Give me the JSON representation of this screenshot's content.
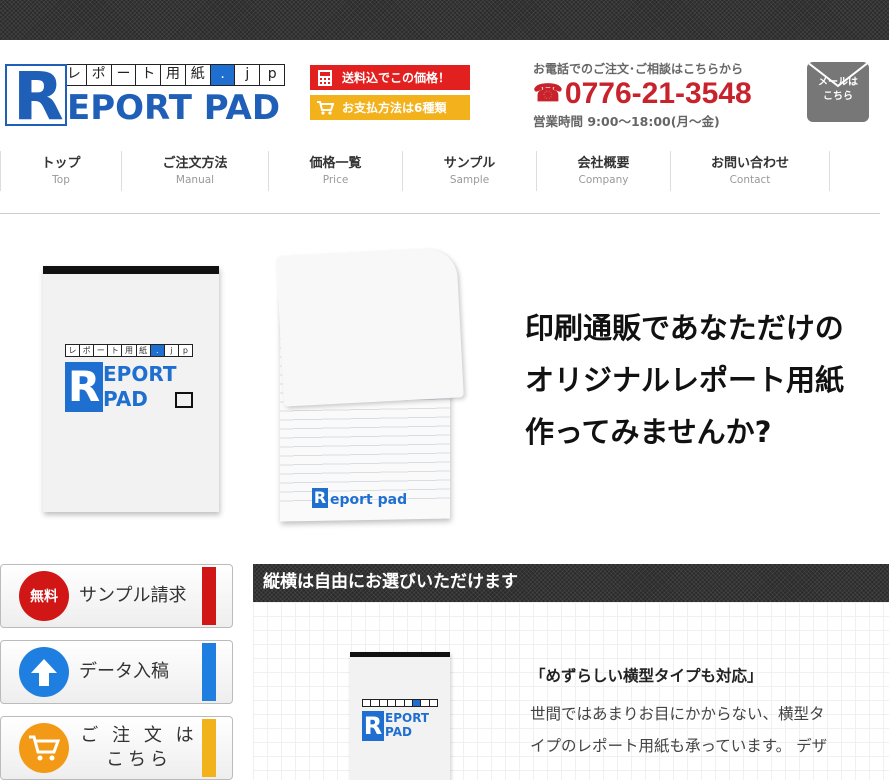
{
  "logo": {
    "kana": [
      "レ",
      "ポ",
      "ー",
      "ト",
      "用",
      "紙",
      ".",
      "j",
      "p"
    ],
    "r": "R",
    "word": "EPORT PAD"
  },
  "badges": [
    {
      "text": "送料込でこの価格！",
      "color": "#e22020",
      "icon": "calculator-icon"
    },
    {
      "text": "お支払方法は6種類",
      "color": "#f3b21c",
      "icon": "cart-icon"
    }
  ],
  "contact": {
    "lead": "お電話でのご注文･ご相談はこちらから",
    "tel": "0776-21-3548",
    "hours": "営業時間 9:00～18:00(月～金)"
  },
  "mail": {
    "line1": "メールは",
    "line2": "こちら"
  },
  "nav": [
    {
      "jp": "トップ",
      "en": "Top"
    },
    {
      "jp": "ご注文方法",
      "en": "Manual"
    },
    {
      "jp": "価格一覧",
      "en": "Price"
    },
    {
      "jp": "サンプル",
      "en": "Sample"
    },
    {
      "jp": "会社概要",
      "en": "Company"
    },
    {
      "jp": "お問い合わせ",
      "en": "Contact"
    }
  ],
  "hero": {
    "line1": "印刷通販であなただけの",
    "line2": "オリジナルレポート用紙",
    "line3": "作ってみませんか?",
    "pad1": {
      "r": "R",
      "t1": "EPORT",
      "t2": "PAD"
    },
    "pad2": {
      "r": "R",
      "t": "eport pad"
    }
  },
  "side": [
    {
      "circle": "無料",
      "label": "サンプル請求",
      "circle_color": "#d11616",
      "bar_color": "#d11616"
    },
    {
      "circle": "",
      "label": "データ入稿",
      "circle_color": "#1e7fe0",
      "bar_color": "#1e7fe0"
    },
    {
      "circle": "",
      "label": "ご 注 文 は こちら",
      "circle_color": "#f29a15",
      "bar_color": "#f2b21c"
    }
  ],
  "content": {
    "header": "縦横は自由にお選びいただけます",
    "heading": "「めずらしい横型タイプも対応」",
    "para1": "世間ではあまりお目にかからない、横型タ",
    "para2": "イプのレポート用紙も承っています。 デザ",
    "pad3": {
      "r": "R",
      "t1": "EPORT",
      "t2": "PAD"
    }
  }
}
